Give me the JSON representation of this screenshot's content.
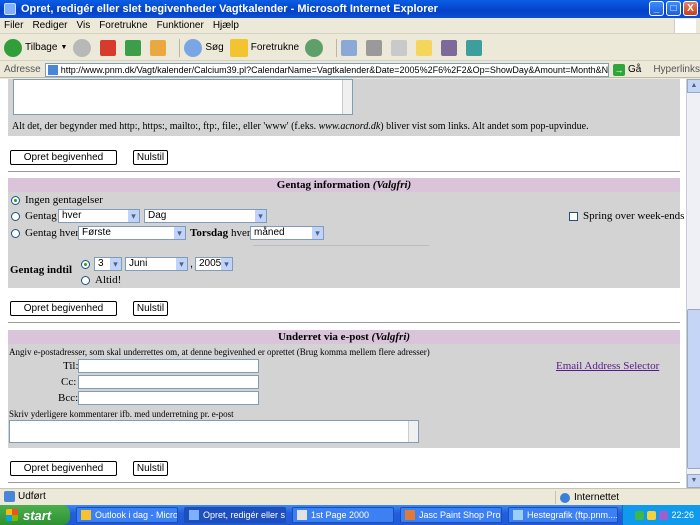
{
  "window": {
    "title": "Opret, redigér eller slet begivenheder Vagtkalender - Microsoft Internet Explorer",
    "buttons": [
      "_",
      "□",
      "X"
    ]
  },
  "menu": [
    "Filer",
    "Rediger",
    "Vis",
    "Foretrukne",
    "Funktioner",
    "Hjælp"
  ],
  "toolbar": {
    "back": "Tilbage",
    "search": "Søg",
    "favorites": "Foretrukne"
  },
  "address": {
    "label": "Adresse",
    "url": "http://www.pnm.dk/Vagt/kalender/Calcium39.pl?CalendarName=Vagtkalender&Date=2005%2F6%2F2&Op=ShowDay&Amount=Month&NavType=Absolute&Type=Bl",
    "go": "Gå",
    "links": "Hyperlinks"
  },
  "page": {
    "links_note_part1": "Alt det, der begynder med http:, https:, mailto:, ftp:, file:, eller 'www' (f.eks.",
    "links_note_example": "www.acnord.dk",
    "links_note_part2": ") bliver vist som links. Alt andet som pop-upvindue.",
    "create_button": "Opret begivenhed",
    "reset_button": "Nulstil",
    "repeat": {
      "header": "Gentag information",
      "header_optional": "(Valgfri)",
      "no_repeat": "Ingen gentagelser",
      "repeat": "Gentag",
      "repeat_every_select": "hver",
      "repeat_unit_select": "Dag",
      "skip_weekends": "Spring over week-ends",
      "repeat_every": "Gentag hver",
      "nth_select": "Første",
      "weekday": "Torsdag",
      "every_word": "hver",
      "period_select": "måned",
      "repeat_until": "Gentag indtil",
      "day_select": "3",
      "month_select": "Juni",
      "comma": ",",
      "year_select": "2005",
      "always": "Altid!"
    },
    "notify": {
      "header": "Underret via e-post",
      "header_optional": "(Valgfri)",
      "instructions": "Angiv e-postadresser, som skal underrettes om, at denne begivenhed er oprettet (Brug komma mellem flere adresser)",
      "to_label": "Til:",
      "cc_label": "Cc:",
      "bcc_label": "Bcc:",
      "selector_link": "Email Address Selector",
      "comments_label": "Skriv yderligere kommentarer ifb. med underretning pr. e-post"
    }
  },
  "status": {
    "text": "Udført",
    "zone": "Internettet"
  },
  "taskbar": {
    "start": "start",
    "tasks": [
      "Outlook i dag - Micros...",
      "Opret, redigér eller sl...",
      "1st Page 2000",
      "Jasc Paint Shop Pro",
      "Hestegrafik (ftp.pnm...."
    ],
    "clock": "22:26"
  }
}
